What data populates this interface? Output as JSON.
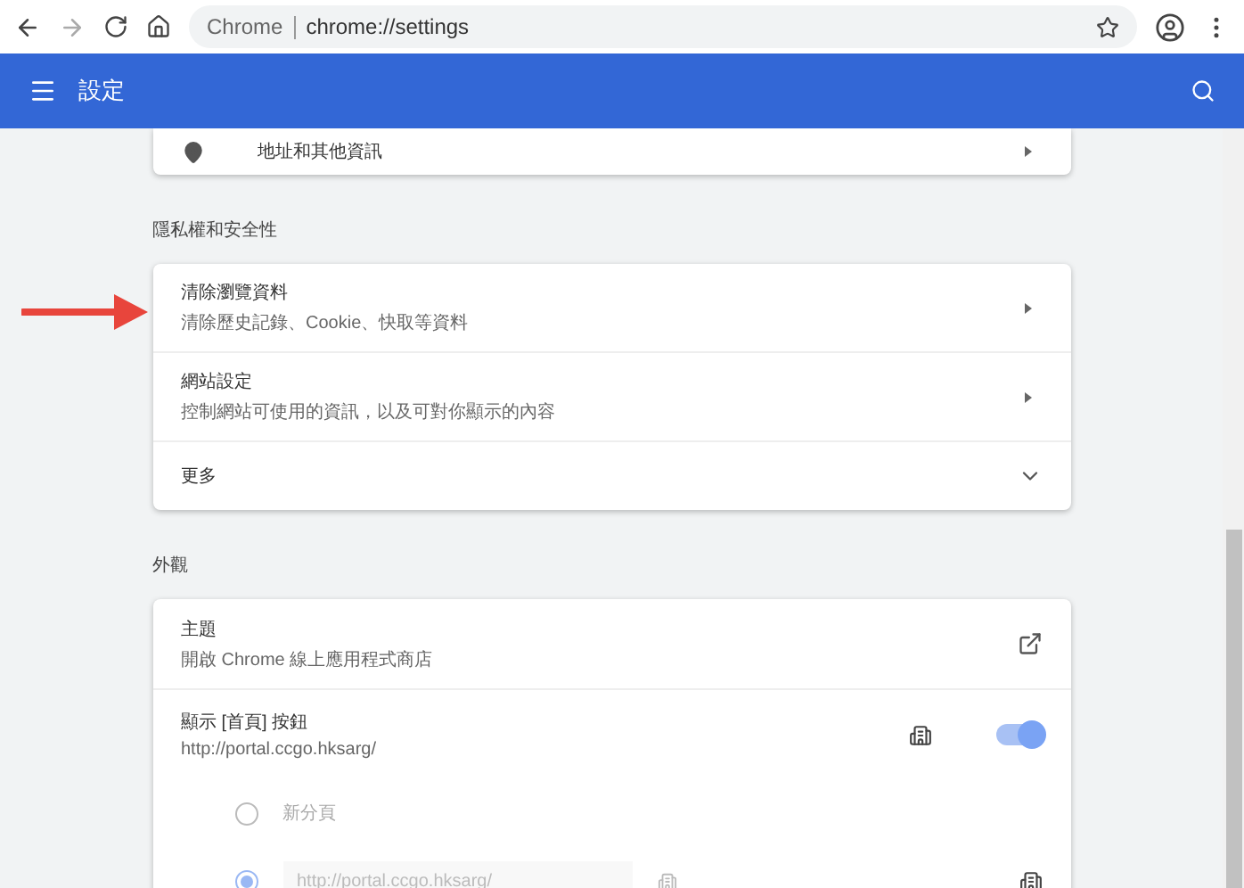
{
  "browser": {
    "site_label": "Chrome",
    "url": "chrome://settings"
  },
  "header": {
    "title": "設定"
  },
  "top_card": {
    "label": "地址和其他資訊"
  },
  "sections": [
    {
      "title": "隱私權和安全性",
      "rows": [
        {
          "kind": "link",
          "title": "清除瀏覽資料",
          "subtitle": "清除歷史記錄、Cookie、快取等資料"
        },
        {
          "kind": "link",
          "title": "網站設定",
          "subtitle": "控制網站可使用的資訊，以及可對你顯示的內容"
        },
        {
          "kind": "expand",
          "title": "更多",
          "expanded": false
        }
      ]
    },
    {
      "title": "外觀",
      "rows": [
        {
          "kind": "external",
          "title": "主題",
          "subtitle": "開啟 Chrome 線上應用程式商店"
        },
        {
          "kind": "toggle",
          "title": "顯示 [首頁] 按鈕",
          "subtitle": "http://portal.ccgo.hksarg/",
          "on": true,
          "managed": true,
          "options": [
            {
              "label": "新分頁",
              "selected": false
            },
            {
              "value": "http://portal.ccgo.hksarg/",
              "selected": true
            }
          ]
        }
      ]
    }
  ]
}
